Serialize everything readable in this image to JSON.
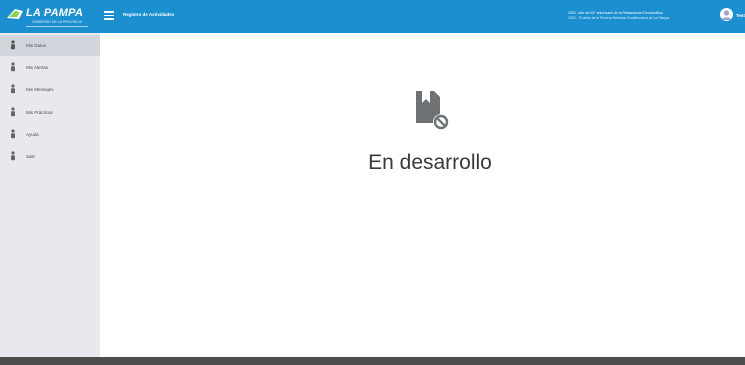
{
  "header": {
    "logo_text": "LA PAMPA",
    "logo_subtitle": "GOBIERNO DE LA PROVINCIA",
    "app_title": "Registro de Actividades",
    "decree_line1": "2023 - año del 40° aniversario de la Restauración Democrática",
    "decree_line2": "2023 - 70 años de la Primera Reforma Constitucional de La Pampa",
    "user_name": "Test",
    "brand_color": "#1b8fd0"
  },
  "sidebar": {
    "items": [
      {
        "label": "Mis Datos",
        "icon": "user-icon",
        "active": true
      },
      {
        "label": "Mis Alertas",
        "icon": "user-icon"
      },
      {
        "label": "Mis Mensajes",
        "icon": "user-icon"
      },
      {
        "label": "Mis Prácticas",
        "icon": "user-icon"
      },
      {
        "label": "Ayuda",
        "icon": "user-icon"
      },
      {
        "label": "Salir",
        "icon": "user-icon"
      }
    ]
  },
  "main": {
    "status_text": "En desarrollo",
    "status_icon": "document-blocked-icon"
  },
  "footer": {
    "color": "#4d4d4d"
  }
}
